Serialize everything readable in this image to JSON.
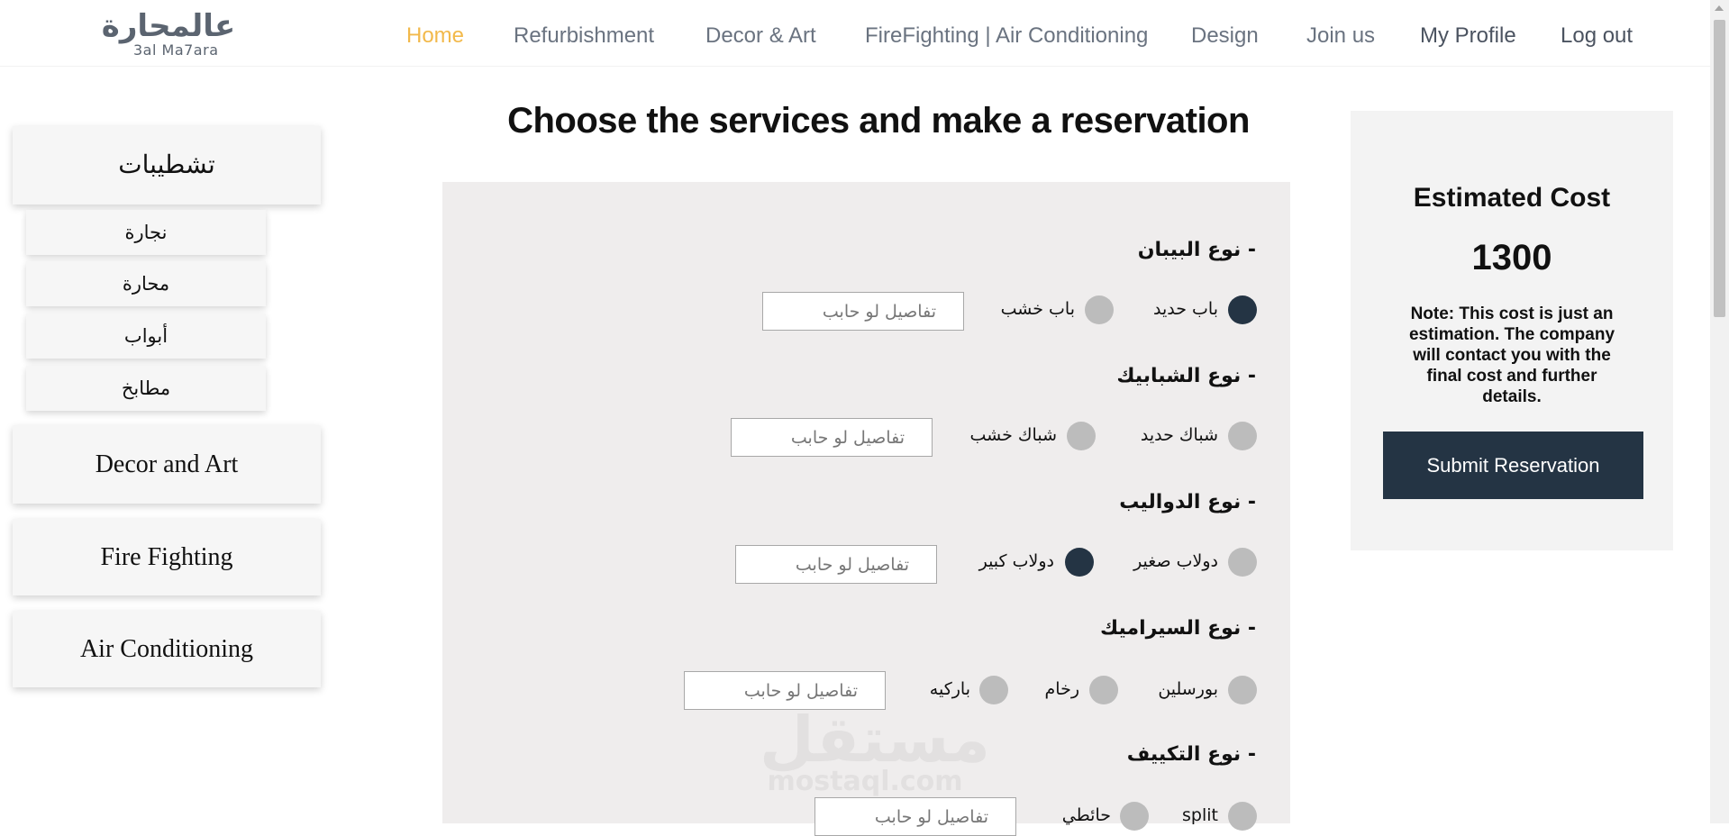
{
  "header": {
    "logo_ar": "عالمحارة",
    "logo_en": "3al Ma7ara",
    "nav": {
      "home": "Home",
      "refurbishment": "Refurbishment",
      "decor_art": "Decor & Art",
      "firefighting": "FireFighting | Air Conditioning",
      "design": "Design",
      "join": "Join us",
      "profile": "My Profile",
      "logout": "Log out"
    },
    "active_color": "#f2b94b"
  },
  "sidebar": {
    "main1": "تشطيبات",
    "subs": [
      "نجارة",
      "محارة",
      "أبواب",
      "مطابخ"
    ],
    "main2": "Decor and Art",
    "main3": "Fire Fighting",
    "main4": "Air Conditioning"
  },
  "main": {
    "title": "Choose the services and make a reservation",
    "input_placeholder": "تفاصيل لو حابب",
    "sections": [
      {
        "title": "- نوع البيبان",
        "options": [
          {
            "label": "باب حديد",
            "checked": true
          },
          {
            "label": "باب خشب",
            "checked": false
          }
        ]
      },
      {
        "title": "- نوع الشبابيك",
        "options": [
          {
            "label": "شباك حديد",
            "checked": false
          },
          {
            "label": "شباك خشب",
            "checked": false
          }
        ]
      },
      {
        "title": "- نوع الدواليب",
        "options": [
          {
            "label": "دولاب صغير",
            "checked": false
          },
          {
            "label": "دولاب كبير",
            "checked": true
          }
        ]
      },
      {
        "title": "- نوع السيراميك",
        "options": [
          {
            "label": "بورسلين",
            "checked": false
          },
          {
            "label": "رخام",
            "checked": false
          },
          {
            "label": "باركيه",
            "checked": false
          }
        ]
      },
      {
        "title": "- نوع التكييف",
        "options": [
          {
            "label": "split",
            "checked": false
          },
          {
            "label": "حائطي",
            "checked": false
          }
        ]
      }
    ]
  },
  "watermark": {
    "ar": "مستقل",
    "en": "mostaql.com"
  },
  "cost": {
    "title": "Estimated Cost",
    "value": "1300",
    "note": "Note: This cost is just an estimation. The company will contact you with the final cost and further details.",
    "submit": "Submit Reservation"
  },
  "colors": {
    "dark": "#243444",
    "radio_off": "#bcbcbc",
    "panel": "#efeded"
  }
}
